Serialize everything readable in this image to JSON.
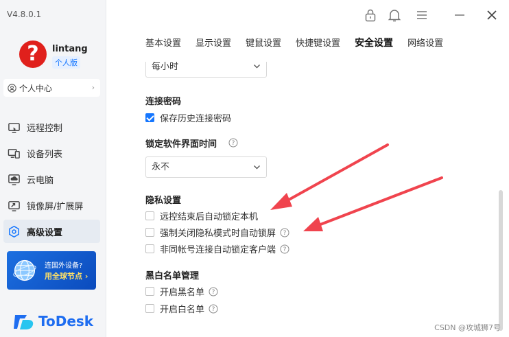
{
  "app": {
    "version": "V4.8.0.1",
    "brand": "ToDesk",
    "accent": "#1677ff"
  },
  "user": {
    "avatar_glyph": "?",
    "name": "lintang",
    "edition": "个人版",
    "personal_center": "个人中心"
  },
  "sidebar": {
    "items": [
      {
        "label": "远程控制",
        "icon": "remote-control-icon"
      },
      {
        "label": "设备列表",
        "icon": "device-list-icon"
      },
      {
        "label": "云电脑",
        "icon": "cloud-pc-icon"
      },
      {
        "label": "镜像屏/扩展屏",
        "icon": "mirror-screen-icon"
      },
      {
        "label": "高级设置",
        "icon": "advanced-settings-icon",
        "active": true
      }
    ],
    "promo": {
      "line1": "连国外设备?",
      "line2": "用全球节点 ›"
    }
  },
  "tabs": [
    {
      "label": "基本设置"
    },
    {
      "label": "显示设置"
    },
    {
      "label": "键鼠设置"
    },
    {
      "label": "快捷键设置"
    },
    {
      "label": "安全设置",
      "active": true
    },
    {
      "label": "网络设置"
    }
  ],
  "content": {
    "top_dropdown": "每小时",
    "conn_password": {
      "title": "连接密码",
      "save_history": {
        "label": "保存历史连接密码",
        "checked": true
      }
    },
    "lock_time": {
      "title": "锁定软件界面时间",
      "value": "永不"
    },
    "privacy": {
      "title": "隐私设置",
      "items": [
        {
          "label": "远控结束后自动锁定本机",
          "checked": false,
          "help": false
        },
        {
          "label": "强制关闭隐私模式时自动锁屏",
          "checked": false,
          "help": true
        },
        {
          "label": "非同帐号连接自动锁定客户端",
          "checked": false,
          "help": true
        }
      ]
    },
    "blackwhite": {
      "title": "黑白名单管理",
      "items": [
        {
          "label": "开启黑名单",
          "checked": false,
          "help": true
        },
        {
          "label": "开启白名单",
          "checked": false,
          "help": true
        }
      ]
    }
  },
  "watermark": "CSDN @攻城狮7号",
  "colors": {
    "annotation_arrow": "#f0444e",
    "avatar": "#e0201c"
  }
}
